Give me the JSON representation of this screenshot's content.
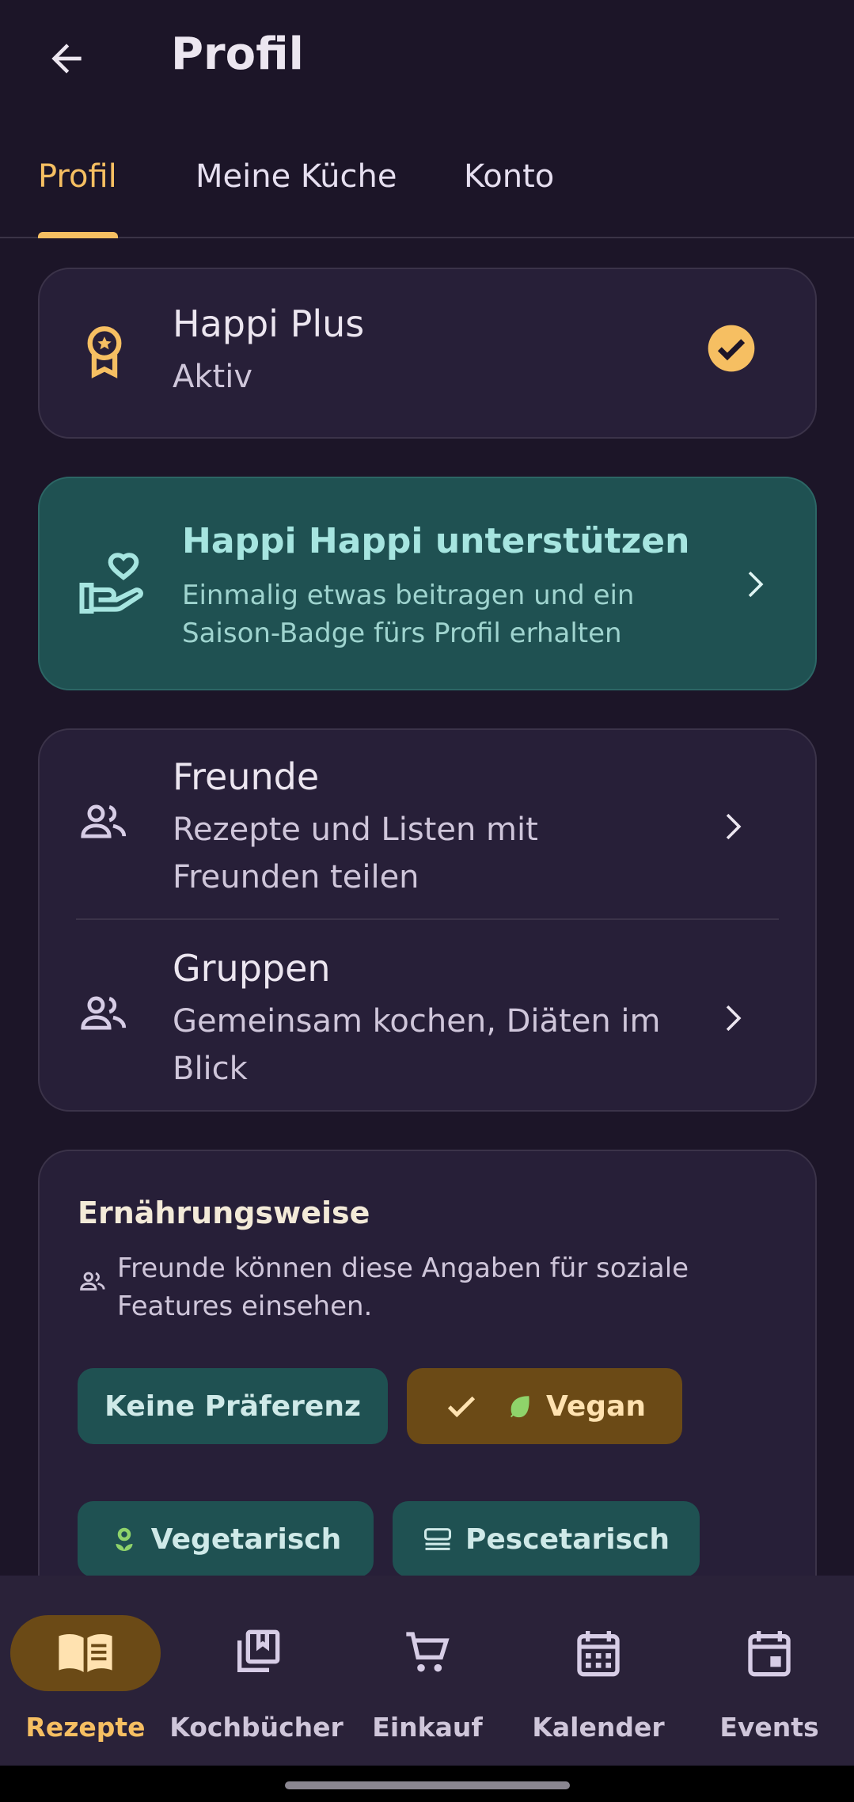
{
  "header": {
    "title": "Profil",
    "back_icon": "arrow-back-icon"
  },
  "tabs": [
    {
      "label": "Profil",
      "active": true
    },
    {
      "label": "Meine Küche",
      "active": false
    },
    {
      "label": "Konto",
      "active": false
    }
  ],
  "plus": {
    "title": "Happi Plus",
    "status": "Aktiv",
    "icon": "award-badge-icon",
    "status_icon": "check-circle-icon"
  },
  "support": {
    "title": "Happi Happi unterstützen",
    "desc_line1": "Einmalig etwas beitragen und ein",
    "desc_line2": "Saison-Badge fürs Profil erhalten",
    "icon": "hand-heart-icon"
  },
  "social": [
    {
      "title": "Freunde",
      "line1": "Rezepte und Listen mit",
      "line2": "Freunden teilen",
      "icon": "people-icon"
    },
    {
      "title": "Gruppen",
      "line1": "Gemeinsam kochen, Diäten im",
      "line2": "Blick",
      "icon": "people-icon"
    }
  ],
  "diet": {
    "title": "Ernährungsweise",
    "note_line1": "Freunde können diese Angaben für soziale",
    "note_line2": "Features einsehen.",
    "options": [
      {
        "label": "Keine Präferenz",
        "selected": false
      },
      {
        "label": "Vegan",
        "selected": true,
        "icon": "leaf-icon"
      },
      {
        "label": "Vegetarisch",
        "selected": false,
        "icon": "flower-icon"
      },
      {
        "label": "Pescetarisch",
        "selected": false,
        "icon": "fish-icon"
      }
    ]
  },
  "nav": [
    {
      "label": "Rezepte",
      "icon": "open-book-icon",
      "active": true
    },
    {
      "label": "Kochbücher",
      "icon": "library-books-icon",
      "active": false
    },
    {
      "label": "Einkauf",
      "icon": "cart-icon",
      "active": false
    },
    {
      "label": "Kalender",
      "icon": "calendar-icon",
      "active": false
    },
    {
      "label": "Events",
      "icon": "event-icon",
      "active": false
    }
  ],
  "colors": {
    "background": "#1c1528",
    "card": "#271f38",
    "accent": "#f6bf62",
    "teal": "#1f5152",
    "selected_chip": "#6b4a16"
  }
}
